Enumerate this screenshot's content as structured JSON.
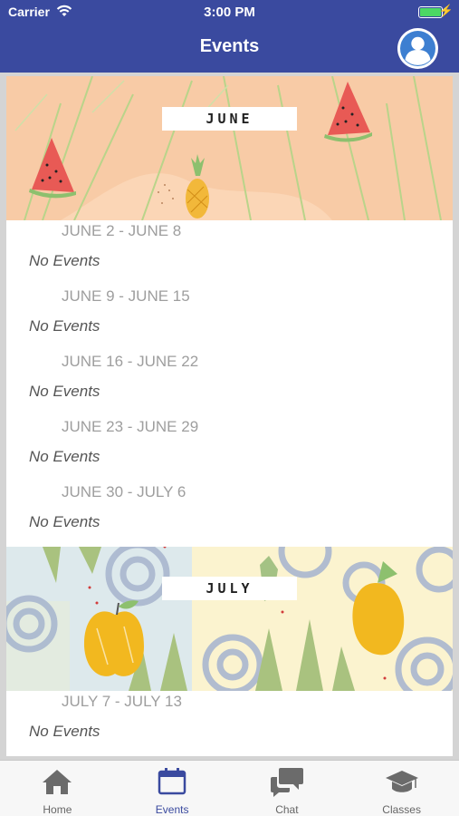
{
  "status_bar": {
    "carrier": "Carrier",
    "time": "3:00 PM"
  },
  "header": {
    "title": "Events"
  },
  "months": [
    {
      "label": "JUNE",
      "weeks": [
        {
          "range": "JUNE 2 - JUNE 8",
          "events": "No Events"
        },
        {
          "range": "JUNE 9 - JUNE 15",
          "events": "No Events"
        },
        {
          "range": "JUNE 16 - JUNE 22",
          "events": "No Events"
        },
        {
          "range": "JUNE 23 - JUNE 29",
          "events": "No Events"
        },
        {
          "range": "JUNE 30 - JULY 6",
          "events": "No Events"
        }
      ]
    },
    {
      "label": "JULY",
      "weeks": [
        {
          "range": "JULY 7 - JULY 13",
          "events": "No Events"
        }
      ]
    }
  ],
  "tabbar": {
    "items": [
      {
        "label": "Home",
        "icon": "home-icon"
      },
      {
        "label": "Events",
        "icon": "calendar-icon"
      },
      {
        "label": "Chat",
        "icon": "chat-icon"
      },
      {
        "label": "Classes",
        "icon": "graduation-cap-icon"
      }
    ],
    "active": "Events"
  },
  "colors": {
    "header": "#3a4a9f",
    "active_tab": "#3a4a9f",
    "battery": "#4cd964"
  }
}
